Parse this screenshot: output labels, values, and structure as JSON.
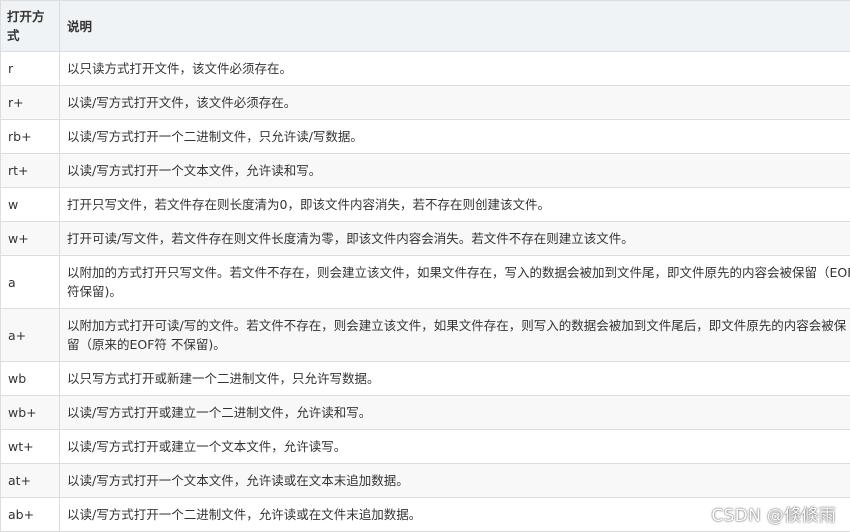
{
  "table": {
    "headers": [
      "打开方式",
      "说明"
    ],
    "rows": [
      {
        "mode": "r",
        "desc": "以只读方式打开文件，该文件必须存在。"
      },
      {
        "mode": "r+",
        "desc": "以读/写方式打开文件，该文件必须存在。"
      },
      {
        "mode": "rb+",
        "desc": "以读/写方式打开一个二进制文件，只允许读/写数据。"
      },
      {
        "mode": "rt+",
        "desc": "以读/写方式打开一个文本文件，允许读和写。"
      },
      {
        "mode": "w",
        "desc": "打开只写文件，若文件存在则长度清为0，即该文件内容消失，若不存在则创建该文件。"
      },
      {
        "mode": "w+",
        "desc": "打开可读/写文件，若文件存在则文件长度清为零，即该文件内容会消失。若文件不存在则建立该文件。"
      },
      {
        "mode": "a",
        "desc": "以附加的方式打开只写文件。若文件不存在，则会建立该文件，如果文件存在，写入的数据会被加到文件尾，即文件原先的内容会被保留（EOF符保留)。"
      },
      {
        "mode": "a+",
        "desc": "以附加方式打开可读/写的文件。若文件不存在，则会建立该文件，如果文件存在，则写入的数据会被加到文件尾后，即文件原先的内容会被保留（原来的EOF符 不保留)。"
      },
      {
        "mode": "wb",
        "desc": "以只写方式打开或新建一个二进制文件，只允许写数据。"
      },
      {
        "mode": "wb+",
        "desc": "以读/写方式打开或建立一个二进制文件，允许读和写。"
      },
      {
        "mode": "wt+",
        "desc": "以读/写方式打开或建立一个文本文件，允许读写。"
      },
      {
        "mode": "at+",
        "desc": "以读/写方式打开一个文本文件，允许读或在文本末追加数据。"
      },
      {
        "mode": "ab+",
        "desc": "以读/写方式打开一个二进制文件，允许读或在文件末追加数据。"
      }
    ]
  },
  "watermark": "CSDN @倏倏雨"
}
